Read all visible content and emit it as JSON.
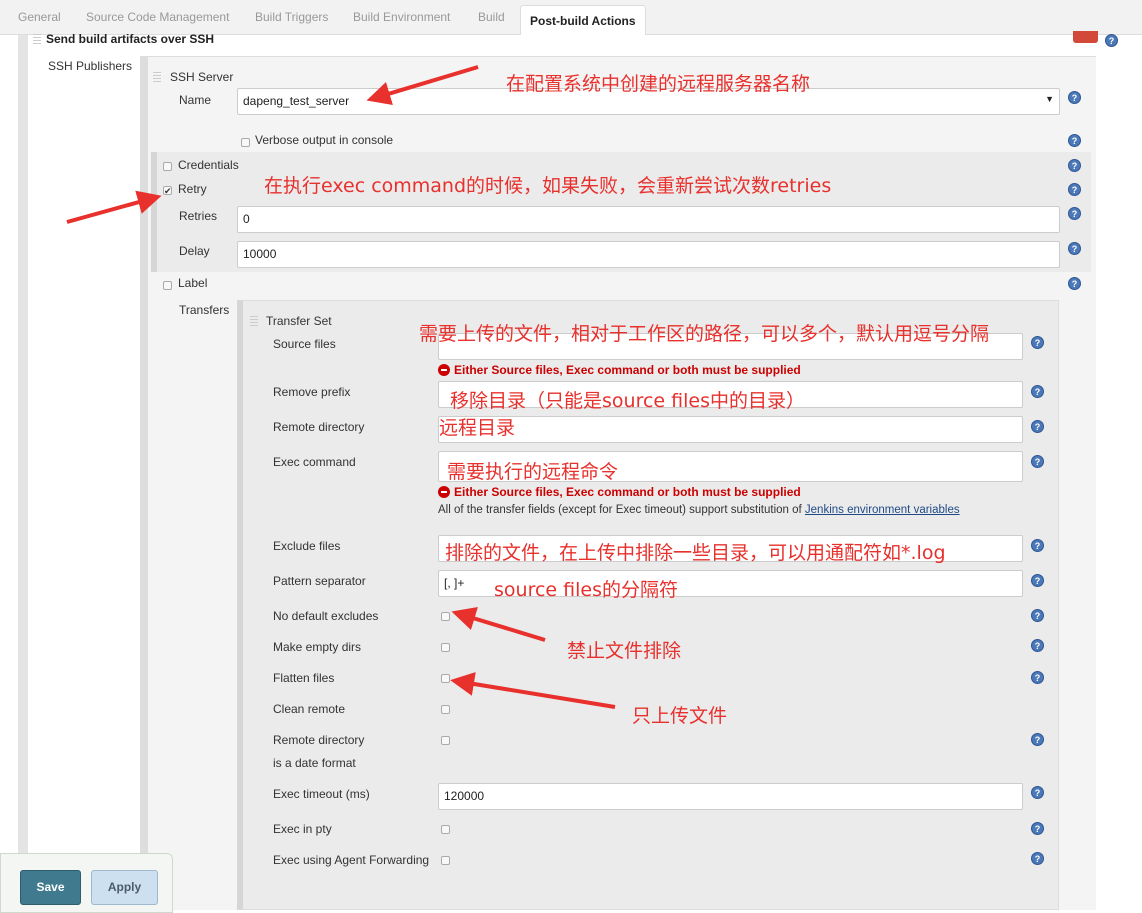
{
  "tabs": [
    "General",
    "Source Code Management",
    "Build Triggers",
    "Build Environment",
    "Build",
    "Post-build Actions"
  ],
  "section": {
    "title": "Send build artifacts over SSH",
    "publishers_label": "SSH Publishers"
  },
  "server": {
    "header": "SSH Server",
    "name_label": "Name",
    "name_value": "dapeng_test_server",
    "verbose_label": "Verbose output in console",
    "credentials_label": "Credentials",
    "retry_label": "Retry",
    "retry_checked": true,
    "retries_label": "Retries",
    "retries_value": "0",
    "delay_label": "Delay",
    "delay_value": "10000",
    "label_label": "Label",
    "transfers_label": "Transfers"
  },
  "transfer": {
    "header": "Transfer Set",
    "source_files": "Source files",
    "error": "Either Source files, Exec command or both must be supplied",
    "remove_prefix": "Remove prefix",
    "remote_directory": "Remote directory",
    "exec_command": "Exec command",
    "info_text": "All of the transfer fields (except for Exec timeout) support substitution of ",
    "info_link": "Jenkins environment variables",
    "exclude_files": "Exclude files",
    "pattern_separator": "Pattern separator",
    "pattern_value": "[, ]+",
    "no_default_excludes": "No default excludes",
    "make_empty_dirs": "Make empty dirs",
    "flatten_files": "Flatten files",
    "clean_remote": "Clean remote",
    "remote_date_1": "Remote directory",
    "remote_date_2": "is a date format",
    "exec_timeout": "Exec timeout (ms)",
    "exec_timeout_value": "120000",
    "exec_in_pty": "Exec in pty",
    "agent_forwarding": "Exec using Agent Forwarding"
  },
  "buttons": {
    "save": "Save",
    "apply": "Apply"
  },
  "annotations": {
    "server_name": "在配置系统中创建的远程服务器名称",
    "retry": "在执行exec command的时候，如果失败，会重新尝试次数retries",
    "source": "需要上传的文件，相对于工作区的路径，可以多个，默认用逗号分隔",
    "remove_prefix": "移除目录（只能是source files中的目录）",
    "remote_dir": "远程目录",
    "exec": "需要执行的远程命令",
    "exclude": "排除的文件，在上传中排除一些目录，可以用通配符如*.log",
    "pattern": "source files的分隔符",
    "no_default": "禁止文件排除",
    "flatten": "只上传文件"
  },
  "colors": {
    "annotation": "#e8302c",
    "save": "#3f7a8e",
    "apply": "#cde0ef",
    "error": "#cc0000"
  }
}
